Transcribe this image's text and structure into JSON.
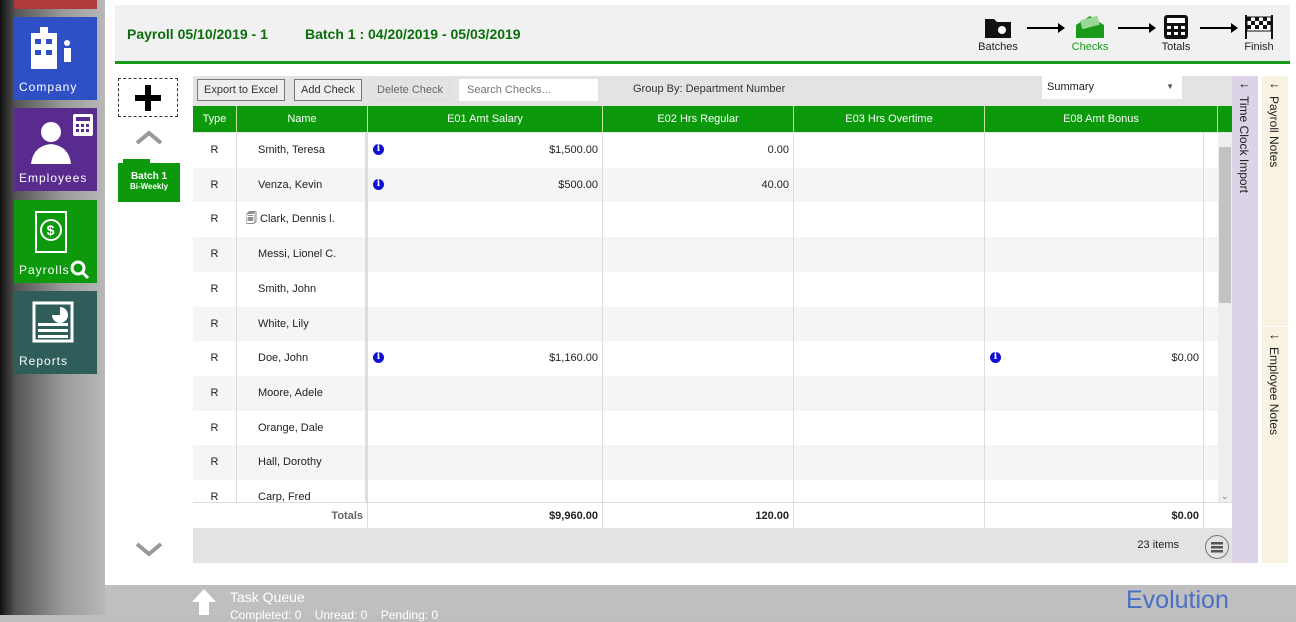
{
  "nav": [
    {
      "label": "Company",
      "icon": "building-icon",
      "color": "#2f4fc7"
    },
    {
      "label": "Employees",
      "icon": "employee-icon",
      "color": "#5a2b8f"
    },
    {
      "label": "Payrolls",
      "icon": "payroll-icon",
      "color": "#0c9a0c"
    },
    {
      "label": "Reports",
      "icon": "report-icon",
      "color": "#2f5e5a"
    }
  ],
  "header": {
    "payroll": "Payroll 05/10/2019 - 1",
    "batch": "Batch 1 : 04/20/2019 - 05/03/2019"
  },
  "steps": [
    {
      "label": "Batches",
      "active": false
    },
    {
      "label": "Checks",
      "active": true
    },
    {
      "label": "Totals",
      "active": false
    },
    {
      "label": "Finish",
      "active": false
    }
  ],
  "batch": {
    "name": "Batch 1",
    "freq": "Bi-Weekly"
  },
  "toolbar": {
    "export": "Export to Excel",
    "add": "Add Check",
    "delete": "Delete Check",
    "search_placeholder": "Search Checks...",
    "group_by": "Group By: Department Number",
    "view": "Summary"
  },
  "columns": [
    "Type",
    "Name",
    "E01 Amt Salary",
    "E02 Hrs Regular",
    "E03 Hrs Overtime",
    "E08 Amt Bonus"
  ],
  "rows": [
    {
      "type": "R",
      "name": "Smith, Teresa",
      "e01": "$1,500.00",
      "e01_info": true,
      "e02": "0.00",
      "e03": "",
      "e08": ""
    },
    {
      "type": "R",
      "name": "Venza, Kevin",
      "e01": "$500.00",
      "e01_info": true,
      "e02": "40.00",
      "e03": "",
      "e08": ""
    },
    {
      "type": "R",
      "name": "Clark, Dennis l.",
      "note": true,
      "e01": "",
      "e02": "",
      "e03": "",
      "e08": ""
    },
    {
      "type": "R",
      "name": "Messi, Lionel C.",
      "e01": "",
      "e02": "",
      "e03": "",
      "e08": ""
    },
    {
      "type": "R",
      "name": "Smith, John",
      "e01": "",
      "e02": "",
      "e03": "",
      "e08": ""
    },
    {
      "type": "R",
      "name": "White, Lily",
      "e01": "",
      "e02": "",
      "e03": "",
      "e08": ""
    },
    {
      "type": "R",
      "name": "Doe, John",
      "e01": "$1,160.00",
      "e01_info": true,
      "e02": "",
      "e03": "",
      "e08": "$0.00",
      "e08_info": true
    },
    {
      "type": "R",
      "name": "Moore, Adele",
      "e01": "",
      "e02": "",
      "e03": "",
      "e08": ""
    },
    {
      "type": "R",
      "name": "Orange, Dale",
      "e01": "",
      "e02": "",
      "e03": "",
      "e08": ""
    },
    {
      "type": "R",
      "name": "Hall, Dorothy",
      "e01": "",
      "e02": "",
      "e03": "",
      "e08": ""
    },
    {
      "type": "R",
      "name": "Carp, Fred",
      "e01": "",
      "e02": "",
      "e03": "",
      "e08": ""
    }
  ],
  "totals": {
    "label": "Totals",
    "e01": "$9,960.00",
    "e02": "120.00",
    "e03": "",
    "e08": "$0.00"
  },
  "footer": {
    "count": "23 items"
  },
  "side": {
    "time_clock": "Time Clock Import",
    "payroll_notes": "Payroll Notes",
    "employee_notes": "Employee Notes"
  },
  "task_queue": {
    "title": "Task Queue",
    "status": "Completed: 0    Unread: 0    Pending: 0"
  },
  "brand": "Evolution"
}
